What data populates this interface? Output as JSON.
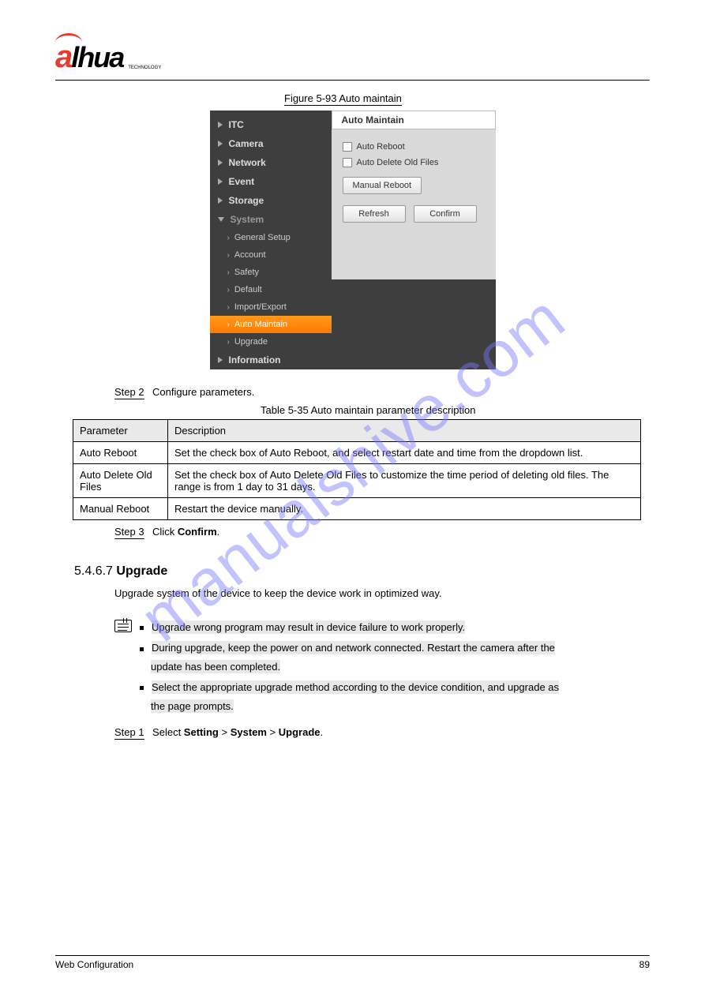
{
  "logo": {
    "text": "alhua",
    "sub": "TECHNOLOGY"
  },
  "figure": {
    "label": "Figure 5-93",
    "title": "Auto maintain"
  },
  "sidebar": {
    "items": [
      {
        "label": "ITC"
      },
      {
        "label": "Camera"
      },
      {
        "label": "Network"
      },
      {
        "label": "Event"
      },
      {
        "label": "Storage"
      },
      {
        "label": "System"
      }
    ],
    "subitems": [
      {
        "label": "General Setup"
      },
      {
        "label": "Account"
      },
      {
        "label": "Safety"
      },
      {
        "label": "Default"
      },
      {
        "label": "Import/Export"
      },
      {
        "label": "Auto Maintain"
      },
      {
        "label": "Upgrade"
      }
    ],
    "last": {
      "label": "Information"
    }
  },
  "panel": {
    "tab": "Auto Maintain",
    "chk1": "Auto Reboot",
    "chk2": "Auto Delete Old Files",
    "btn_manual": "Manual Reboot",
    "btn_refresh": "Refresh",
    "btn_confirm": "Confirm"
  },
  "step2": {
    "label": "Step 2",
    "text": "Configure parameters."
  },
  "table_caption": "Table 5-35 Auto maintain parameter description",
  "table": {
    "h1": "Parameter",
    "h2": "Description",
    "rows": [
      {
        "p": "Auto Reboot",
        "d": "Set the check box of Auto Reboot, and select restart date and time from the dropdown list."
      },
      {
        "p": "Auto Delete Old Files",
        "d": "Set the check box of Auto Delete Old Files to customize the time period of deleting old files. The range is from 1 day to 31 days."
      },
      {
        "p": "Manual Reboot",
        "d": "Restart the device manually."
      }
    ]
  },
  "step3": {
    "label": "Step 3",
    "text": "Click Confirm.",
    "bold": "Confirm"
  },
  "section": {
    "num": "5.4.6.7",
    "title": "Upgrade"
  },
  "section_body": "Upgrade system of the device to keep the device work in optimized way.",
  "notes": {
    "n1": "Upgrade wrong program may result in device failure to work properly.",
    "n2a": "During upgrade, keep the power on and network connected. Restart the camera after the",
    "n2b": "update has been completed.",
    "n3a": "Select the appropriate upgrade method according to the device condition, and upgrade as",
    "n3b": "the page prompts."
  },
  "post_note_step": {
    "label": "Step 1",
    "text": "Select Setting > System > Upgrade."
  },
  "footer": {
    "left": "Web Configuration",
    "right": "89"
  }
}
